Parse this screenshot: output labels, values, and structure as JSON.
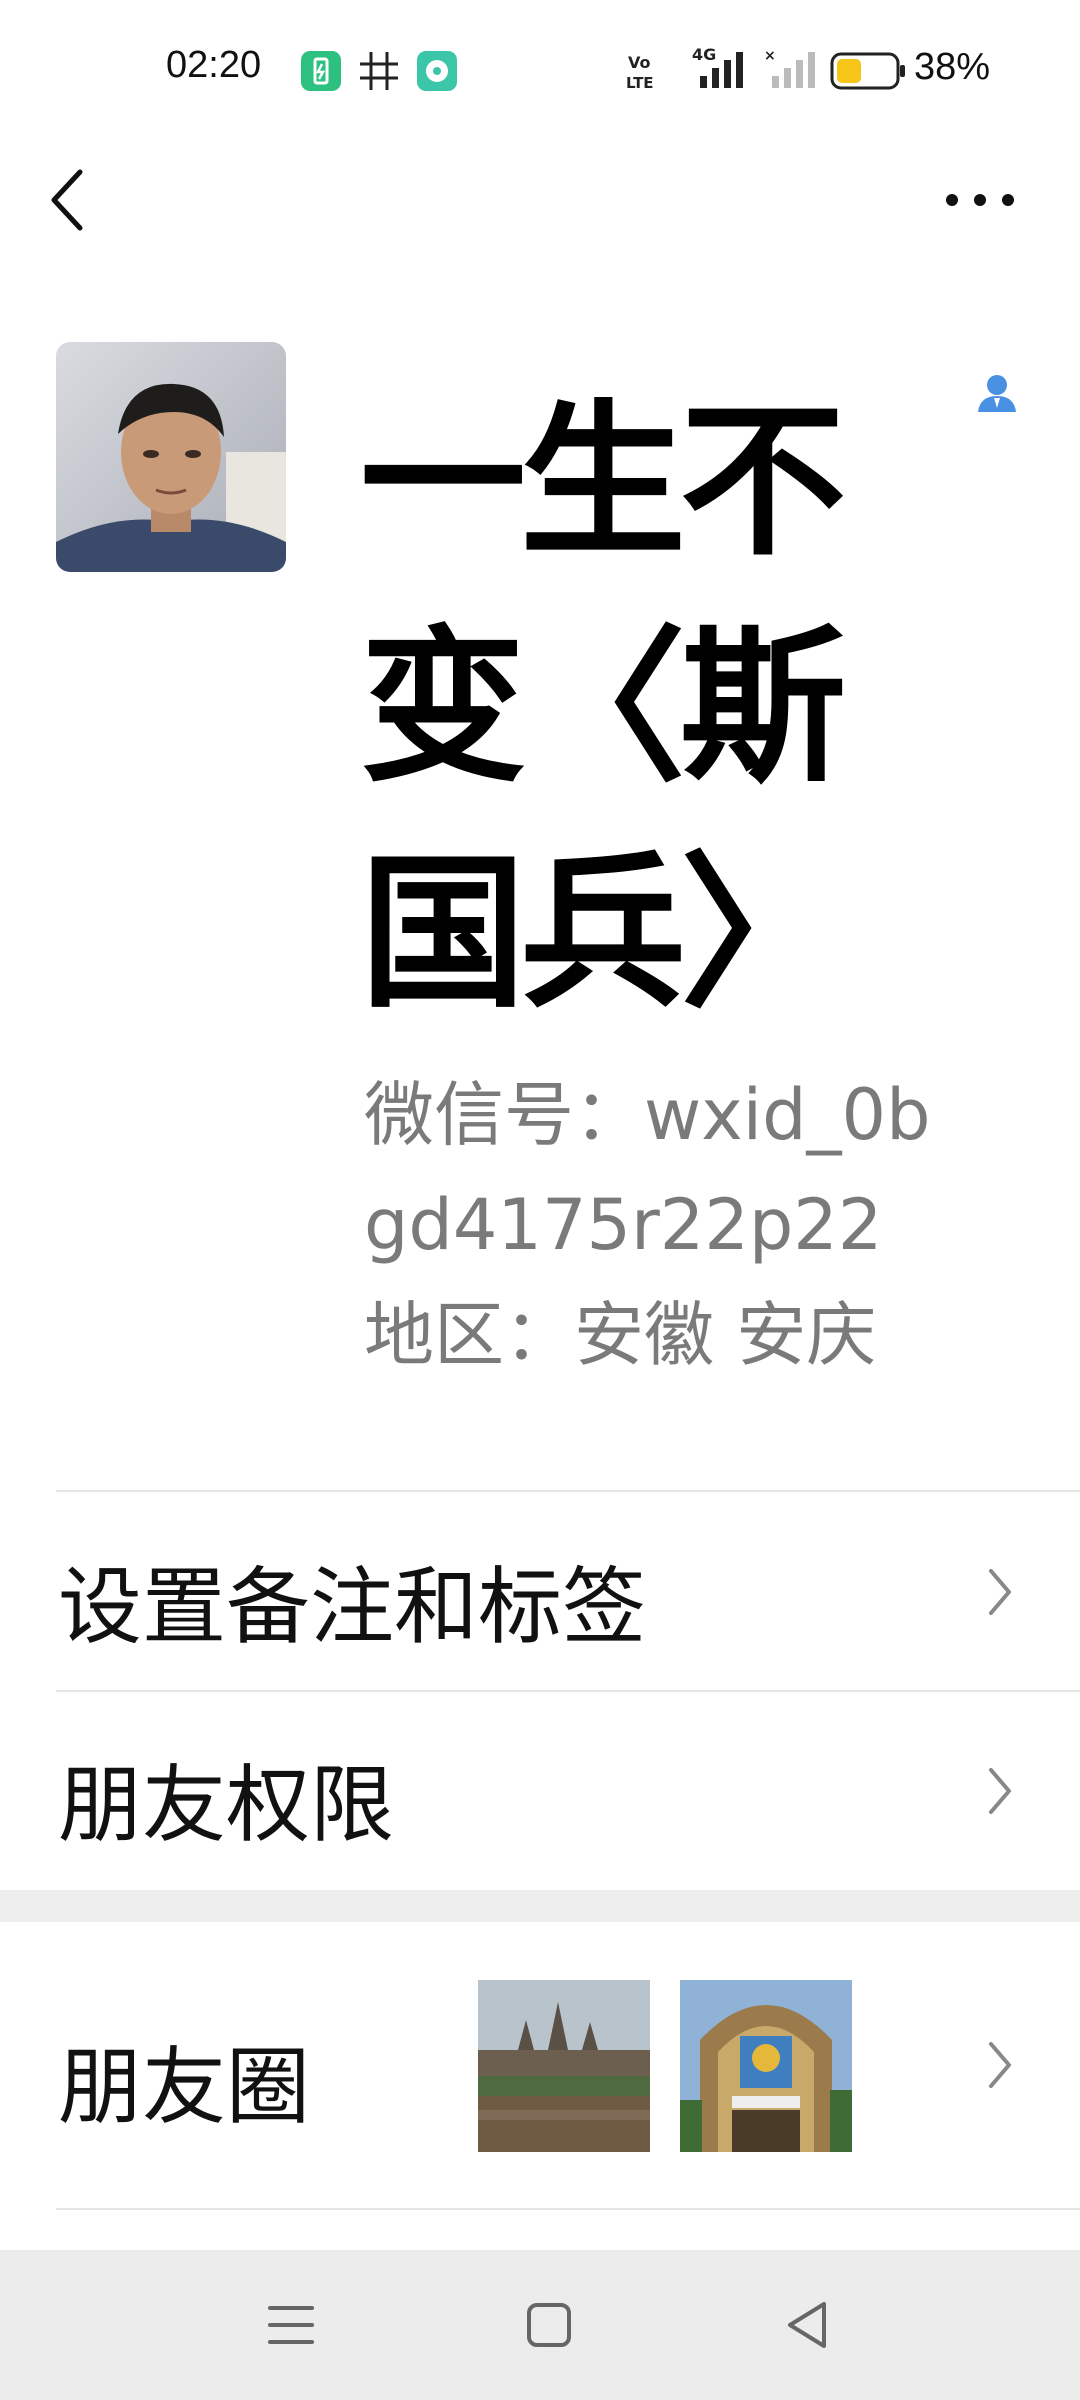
{
  "status_bar": {
    "time": "02:20",
    "battery_percent": "38%",
    "network": "4G",
    "volte": "Vo LTE",
    "icons": [
      "charging-app-icon",
      "grid-app-icon",
      "music-app-icon",
      "volte-icon",
      "signal-4g-icon",
      "signal-empty-icon",
      "battery-icon"
    ]
  },
  "nav": {
    "back_icon": "chevron-left-icon",
    "more_icon": "more-dots-icon"
  },
  "profile": {
    "display_name": "一生不变〈斯国兵〉",
    "wechat_id": "微信号：wxid_0bgd4175r22p22",
    "region": "地区：安徽  安庆",
    "badge_icon": "contact-person-icon"
  },
  "menu": {
    "remark_tags_label": "设置备注和标签",
    "friend_permissions_label": "朋友权限",
    "moments_label": "朋友圈"
  },
  "colors": {
    "accent_blue": "#4a90e2",
    "battery_fill": "#f5c518",
    "app_green": "#2dc181",
    "section_gap": "#ededed"
  }
}
